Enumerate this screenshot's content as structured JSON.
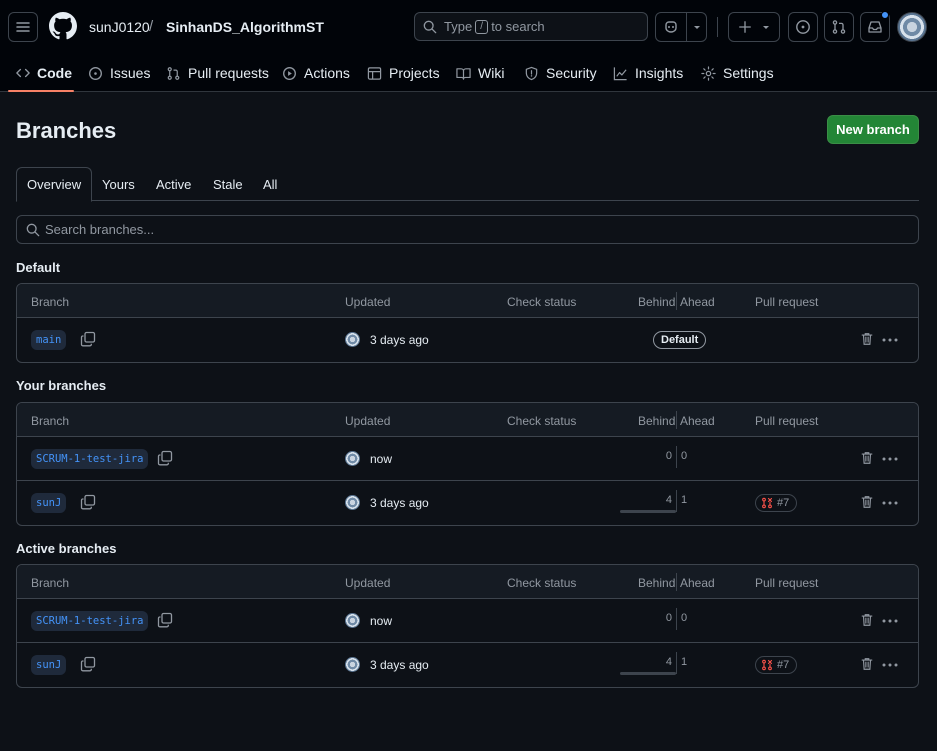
{
  "header": {
    "owner": "sunJ0120",
    "separator": "/",
    "repo": "SinhanDS_AlgorithmST",
    "search_prefix": "Type",
    "search_key": "/",
    "search_suffix": "to search"
  },
  "nav": [
    {
      "label": "Code",
      "icon": "code-icon",
      "active": true
    },
    {
      "label": "Issues",
      "icon": "issue-icon"
    },
    {
      "label": "Pull requests",
      "icon": "pull-request-icon"
    },
    {
      "label": "Actions",
      "icon": "play-icon"
    },
    {
      "label": "Projects",
      "icon": "table-icon"
    },
    {
      "label": "Wiki",
      "icon": "book-icon"
    },
    {
      "label": "Security",
      "icon": "shield-icon"
    },
    {
      "label": "Insights",
      "icon": "graph-icon"
    },
    {
      "label": "Settings",
      "icon": "gear-icon"
    }
  ],
  "page": {
    "title": "Branches",
    "new_branch_label": "New branch",
    "search_placeholder": "Search branches..."
  },
  "tabs": [
    "Overview",
    "Yours",
    "Active",
    "Stale",
    "All"
  ],
  "columns": [
    "Branch",
    "Updated",
    "Check status",
    "Behind",
    "Ahead",
    "Pull request"
  ],
  "sections": [
    {
      "title": "Default",
      "rows": [
        {
          "branch": "main",
          "updated": "3 days ago",
          "badge": "Default"
        }
      ]
    },
    {
      "title": "Your branches",
      "rows": [
        {
          "branch": "SCRUM-1-test-jira",
          "updated": "now",
          "behind": "0",
          "ahead": "0"
        },
        {
          "branch": "sunJ",
          "updated": "3 days ago",
          "behind": "4",
          "ahead": "1",
          "pr": "#7"
        }
      ]
    },
    {
      "title": "Active branches",
      "rows": [
        {
          "branch": "SCRUM-1-test-jira",
          "updated": "now",
          "behind": "0",
          "ahead": "0"
        },
        {
          "branch": "sunJ",
          "updated": "3 days ago",
          "behind": "4",
          "ahead": "1",
          "pr": "#7"
        }
      ]
    }
  ],
  "colors": {
    "accent": "#f78166",
    "primary_button": "#238636",
    "link": "#4493f8",
    "pr_closed": "#f85149"
  }
}
